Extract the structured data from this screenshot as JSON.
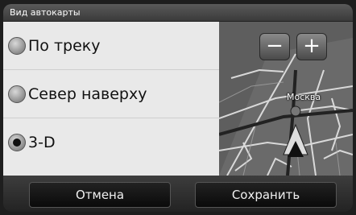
{
  "window": {
    "title": "Вид автокарты"
  },
  "options": [
    {
      "label": "По треку",
      "selected": false
    },
    {
      "label": "Север наверху",
      "selected": false
    },
    {
      "label": "3-D",
      "selected": true
    }
  ],
  "map": {
    "zoom_out_label": "−",
    "zoom_in_label": "+",
    "city_label": "Москва"
  },
  "buttons": {
    "cancel_label": "Отмена",
    "save_label": "Сохранить"
  }
}
